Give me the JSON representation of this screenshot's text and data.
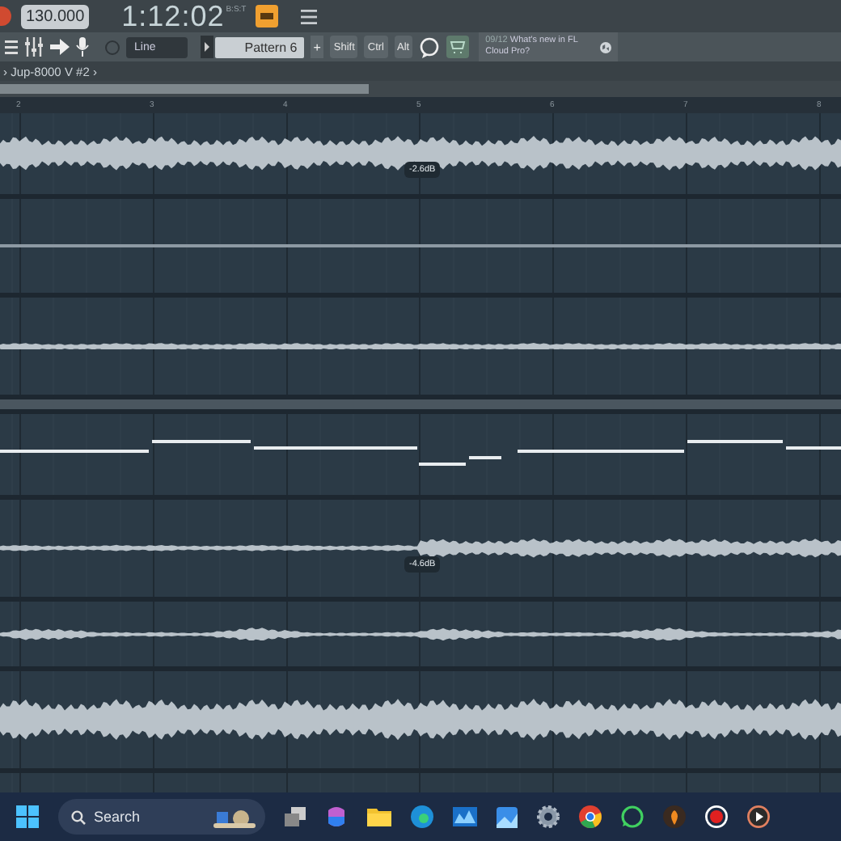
{
  "toolbar": {
    "tempo": "130.000",
    "time": "1:12:02",
    "time_unit": "B:S:T"
  },
  "toolbar2": {
    "snap": "Line",
    "pattern": "Pattern 6",
    "plus": "+",
    "keys": [
      "Shift",
      "Ctrl",
      "Alt"
    ],
    "hint": {
      "date": "09/12",
      "text": "What's new in FL Cloud Pro?"
    }
  },
  "breadcrumb": {
    "prefix": "›",
    "title": "Jup-8000 V #2",
    "suffix": "›"
  },
  "ruler": [
    "2",
    "3",
    "4",
    "5",
    "6",
    "7",
    "8"
  ],
  "tracks": [
    {
      "kind": "dense",
      "label": "-2.6dB"
    },
    {
      "kind": "flat"
    },
    {
      "kind": "thin"
    },
    {
      "kind": "divider"
    },
    {
      "kind": "automation"
    },
    {
      "kind": "rising",
      "label": "-4.6dB"
    },
    {
      "kind": "sparse"
    },
    {
      "kind": "dense"
    },
    {
      "kind": "empty"
    }
  ],
  "taskbar": {
    "search": "Search"
  }
}
